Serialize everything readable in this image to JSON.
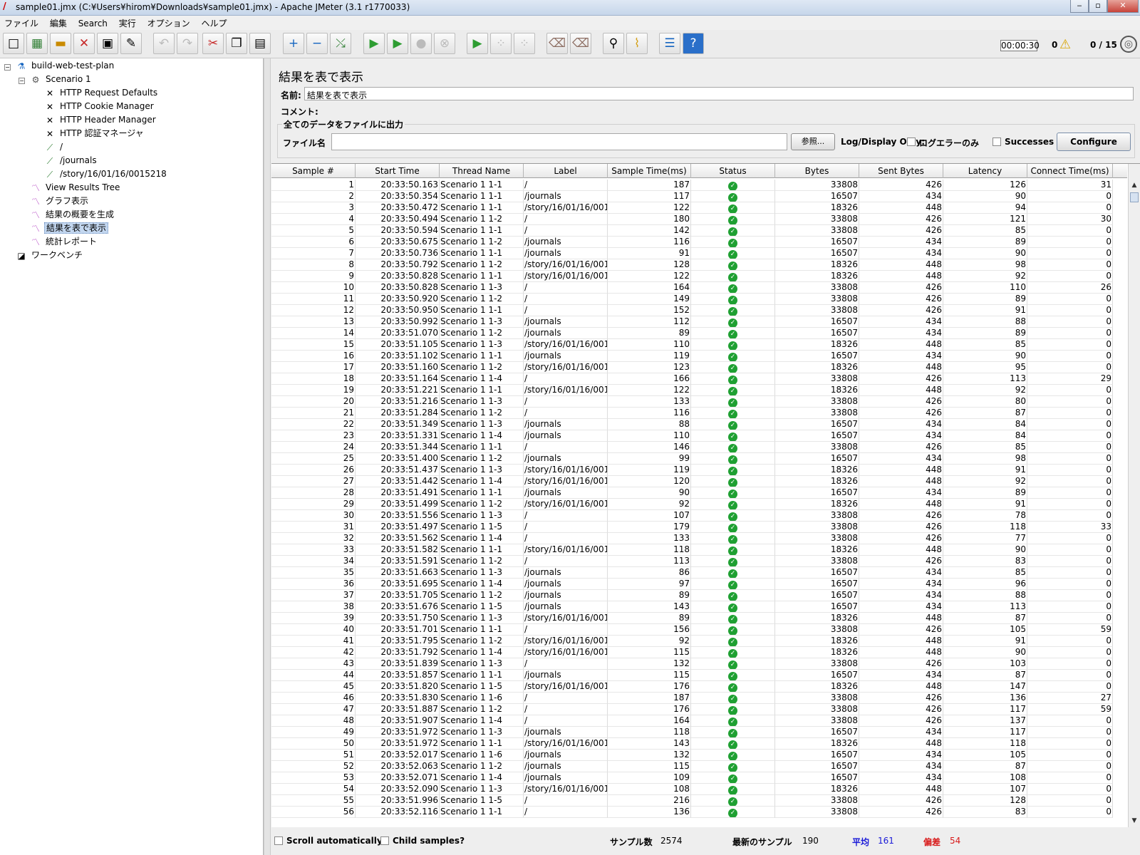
{
  "window": {
    "title": "sample01.jmx (C:¥Users¥hirom¥Downloads¥sample01.jmx) - Apache JMeter (3.1 r1770033)",
    "buttons": {
      "minimize": "‒",
      "maximize": "▫",
      "close": "✕"
    }
  },
  "menu": [
    "ファイル",
    "編集",
    "Search",
    "実行",
    "オプション",
    "ヘルプ"
  ],
  "toolbar": {
    "elapsed": "00:00:30",
    "warnings": "0",
    "threads": "0 / 15"
  },
  "tree": {
    "nodes": [
      {
        "label": "build-web-test-plan",
        "icon": "test-plan-icon"
      },
      {
        "label": "Scenario 1",
        "icon": "thread-group-icon"
      },
      {
        "label": "HTTP Request Defaults",
        "icon": "config-wrench-icon"
      },
      {
        "label": "HTTP Cookie Manager",
        "icon": "config-wrench-icon"
      },
      {
        "label": "HTTP Header Manager",
        "icon": "config-wrench-icon"
      },
      {
        "label": "HTTP 認証マネージャ",
        "icon": "config-wrench-icon"
      },
      {
        "label": "/",
        "icon": "sampler-pipette-icon"
      },
      {
        "label": "/journals",
        "icon": "sampler-pipette-icon"
      },
      {
        "label": "/story/16/01/16/0015218",
        "icon": "sampler-pipette-icon"
      },
      {
        "label": "View Results Tree",
        "icon": "listener-chart-icon"
      },
      {
        "label": "グラフ表示",
        "icon": "listener-chart-icon"
      },
      {
        "label": "結果の概要を生成",
        "icon": "listener-chart-icon"
      },
      {
        "label": "結果を表で表示",
        "icon": "listener-chart-icon"
      },
      {
        "label": "統計レポート",
        "icon": "listener-chart-icon"
      },
      {
        "label": "ワークベンチ",
        "icon": "workbench-icon"
      }
    ]
  },
  "panel": {
    "title": "結果を表で表示",
    "name_label": "名前:",
    "name_value": "結果を表で表示",
    "comment_label": "コメント:",
    "file_group_title": "全てのデータをファイルに出力",
    "file_label": "ファイル名",
    "browse_button": "参照...",
    "log_display_only": "Log/Display Only:",
    "errors_only": "ログエラーのみ",
    "successes": "Successes",
    "configure_button": "Configure"
  },
  "table": {
    "columns": [
      "Sample #",
      "Start Time",
      "Thread Name",
      "Label",
      "Sample Time(ms)",
      "Status",
      "Bytes",
      "Sent Bytes",
      "Latency",
      "Connect Time(ms)"
    ],
    "rows": [
      [
        1,
        "20:33:50.163",
        "Scenario 1 1-1",
        "/",
        187,
        "ok",
        33808,
        426,
        126,
        31
      ],
      [
        2,
        "20:33:50.354",
        "Scenario 1 1-1",
        "/journals",
        117,
        "ok",
        16507,
        434,
        90,
        0
      ],
      [
        3,
        "20:33:50.472",
        "Scenario 1 1-1",
        "/story/16/01/16/001...",
        122,
        "ok",
        18326,
        448,
        94,
        0
      ],
      [
        4,
        "20:33:50.494",
        "Scenario 1 1-2",
        "/",
        180,
        "ok",
        33808,
        426,
        121,
        30
      ],
      [
        5,
        "20:33:50.594",
        "Scenario 1 1-1",
        "/",
        142,
        "ok",
        33808,
        426,
        85,
        0
      ],
      [
        6,
        "20:33:50.675",
        "Scenario 1 1-2",
        "/journals",
        116,
        "ok",
        16507,
        434,
        89,
        0
      ],
      [
        7,
        "20:33:50.736",
        "Scenario 1 1-1",
        "/journals",
        91,
        "ok",
        16507,
        434,
        90,
        0
      ],
      [
        8,
        "20:33:50.792",
        "Scenario 1 1-2",
        "/story/16/01/16/001...",
        128,
        "ok",
        18326,
        448,
        98,
        0
      ],
      [
        9,
        "20:33:50.828",
        "Scenario 1 1-1",
        "/story/16/01/16/001...",
        122,
        "ok",
        18326,
        448,
        92,
        0
      ],
      [
        10,
        "20:33:50.828",
        "Scenario 1 1-3",
        "/",
        164,
        "ok",
        33808,
        426,
        110,
        26
      ],
      [
        11,
        "20:33:50.920",
        "Scenario 1 1-2",
        "/",
        149,
        "ok",
        33808,
        426,
        89,
        0
      ],
      [
        12,
        "20:33:50.950",
        "Scenario 1 1-1",
        "/",
        152,
        "ok",
        33808,
        426,
        91,
        0
      ],
      [
        13,
        "20:33:50.992",
        "Scenario 1 1-3",
        "/journals",
        112,
        "ok",
        16507,
        434,
        88,
        0
      ],
      [
        14,
        "20:33:51.070",
        "Scenario 1 1-2",
        "/journals",
        89,
        "ok",
        16507,
        434,
        89,
        0
      ],
      [
        15,
        "20:33:51.105",
        "Scenario 1 1-3",
        "/story/16/01/16/001...",
        110,
        "ok",
        18326,
        448,
        85,
        0
      ],
      [
        16,
        "20:33:51.102",
        "Scenario 1 1-1",
        "/journals",
        119,
        "ok",
        16507,
        434,
        90,
        0
      ],
      [
        17,
        "20:33:51.160",
        "Scenario 1 1-2",
        "/story/16/01/16/001...",
        123,
        "ok",
        18326,
        448,
        95,
        0
      ],
      [
        18,
        "20:33:51.164",
        "Scenario 1 1-4",
        "/",
        166,
        "ok",
        33808,
        426,
        113,
        29
      ],
      [
        19,
        "20:33:51.221",
        "Scenario 1 1-1",
        "/story/16/01/16/001...",
        122,
        "ok",
        18326,
        448,
        92,
        0
      ],
      [
        20,
        "20:33:51.216",
        "Scenario 1 1-3",
        "/",
        133,
        "ok",
        33808,
        426,
        80,
        0
      ],
      [
        21,
        "20:33:51.284",
        "Scenario 1 1-2",
        "/",
        116,
        "ok",
        33808,
        426,
        87,
        0
      ],
      [
        22,
        "20:33:51.349",
        "Scenario 1 1-3",
        "/journals",
        88,
        "ok",
        16507,
        434,
        84,
        0
      ],
      [
        23,
        "20:33:51.331",
        "Scenario 1 1-4",
        "/journals",
        110,
        "ok",
        16507,
        434,
        84,
        0
      ],
      [
        24,
        "20:33:51.344",
        "Scenario 1 1-1",
        "/",
        146,
        "ok",
        33808,
        426,
        85,
        0
      ],
      [
        25,
        "20:33:51.400",
        "Scenario 1 1-2",
        "/journals",
        99,
        "ok",
        16507,
        434,
        98,
        0
      ],
      [
        26,
        "20:33:51.437",
        "Scenario 1 1-3",
        "/story/16/01/16/001...",
        119,
        "ok",
        18326,
        448,
        91,
        0
      ],
      [
        27,
        "20:33:51.442",
        "Scenario 1 1-4",
        "/story/16/01/16/001...",
        120,
        "ok",
        18326,
        448,
        92,
        0
      ],
      [
        28,
        "20:33:51.491",
        "Scenario 1 1-1",
        "/journals",
        90,
        "ok",
        16507,
        434,
        89,
        0
      ],
      [
        29,
        "20:33:51.499",
        "Scenario 1 1-2",
        "/story/16/01/16/001...",
        92,
        "ok",
        18326,
        448,
        91,
        0
      ],
      [
        30,
        "20:33:51.556",
        "Scenario 1 1-3",
        "/",
        107,
        "ok",
        33808,
        426,
        78,
        0
      ],
      [
        31,
        "20:33:51.497",
        "Scenario 1 1-5",
        "/",
        179,
        "ok",
        33808,
        426,
        118,
        33
      ],
      [
        32,
        "20:33:51.562",
        "Scenario 1 1-4",
        "/",
        133,
        "ok",
        33808,
        426,
        77,
        0
      ],
      [
        33,
        "20:33:51.582",
        "Scenario 1 1-1",
        "/story/16/01/16/001...",
        118,
        "ok",
        18326,
        448,
        90,
        0
      ],
      [
        34,
        "20:33:51.591",
        "Scenario 1 1-2",
        "/",
        113,
        "ok",
        33808,
        426,
        83,
        0
      ],
      [
        35,
        "20:33:51.663",
        "Scenario 1 1-3",
        "/journals",
        86,
        "ok",
        16507,
        434,
        85,
        0
      ],
      [
        36,
        "20:33:51.695",
        "Scenario 1 1-4",
        "/journals",
        97,
        "ok",
        16507,
        434,
        96,
        0
      ],
      [
        37,
        "20:33:51.705",
        "Scenario 1 1-2",
        "/journals",
        89,
        "ok",
        16507,
        434,
        88,
        0
      ],
      [
        38,
        "20:33:51.676",
        "Scenario 1 1-5",
        "/journals",
        143,
        "ok",
        16507,
        434,
        113,
        0
      ],
      [
        39,
        "20:33:51.750",
        "Scenario 1 1-3",
        "/story/16/01/16/001...",
        89,
        "ok",
        18326,
        448,
        87,
        0
      ],
      [
        40,
        "20:33:51.701",
        "Scenario 1 1-1",
        "/",
        156,
        "ok",
        33808,
        426,
        105,
        59
      ],
      [
        41,
        "20:33:51.795",
        "Scenario 1 1-2",
        "/story/16/01/16/001...",
        92,
        "ok",
        18326,
        448,
        91,
        0
      ],
      [
        42,
        "20:33:51.792",
        "Scenario 1 1-4",
        "/story/16/01/16/001...",
        115,
        "ok",
        18326,
        448,
        90,
        0
      ],
      [
        43,
        "20:33:51.839",
        "Scenario 1 1-3",
        "/",
        132,
        "ok",
        33808,
        426,
        103,
        0
      ],
      [
        44,
        "20:33:51.857",
        "Scenario 1 1-1",
        "/journals",
        115,
        "ok",
        16507,
        434,
        87,
        0
      ],
      [
        45,
        "20:33:51.820",
        "Scenario 1 1-5",
        "/story/16/01/16/001...",
        176,
        "ok",
        18326,
        448,
        147,
        0
      ],
      [
        46,
        "20:33:51.830",
        "Scenario 1 1-6",
        "/",
        187,
        "ok",
        33808,
        426,
        136,
        27
      ],
      [
        47,
        "20:33:51.887",
        "Scenario 1 1-2",
        "/",
        176,
        "ok",
        33808,
        426,
        117,
        59
      ],
      [
        48,
        "20:33:51.907",
        "Scenario 1 1-4",
        "/",
        164,
        "ok",
        33808,
        426,
        137,
        0
      ],
      [
        49,
        "20:33:51.972",
        "Scenario 1 1-3",
        "/journals",
        118,
        "ok",
        16507,
        434,
        117,
        0
      ],
      [
        50,
        "20:33:51.972",
        "Scenario 1 1-1",
        "/story/16/01/16/001...",
        143,
        "ok",
        18326,
        448,
        118,
        0
      ],
      [
        51,
        "20:33:52.017",
        "Scenario 1 1-6",
        "/journals",
        132,
        "ok",
        16507,
        434,
        105,
        0
      ],
      [
        52,
        "20:33:52.063",
        "Scenario 1 1-2",
        "/journals",
        115,
        "ok",
        16507,
        434,
        87,
        0
      ],
      [
        53,
        "20:33:52.071",
        "Scenario 1 1-4",
        "/journals",
        109,
        "ok",
        16507,
        434,
        108,
        0
      ],
      [
        54,
        "20:33:52.090",
        "Scenario 1 1-3",
        "/story/16/01/16/001...",
        108,
        "ok",
        18326,
        448,
        107,
        0
      ],
      [
        55,
        "20:33:51.996",
        "Scenario 1 1-5",
        "/",
        216,
        "ok",
        33808,
        426,
        128,
        0
      ],
      [
        56,
        "20:33:52.116",
        "Scenario 1 1-1",
        "/",
        136,
        "ok",
        33808,
        426,
        83,
        0
      ]
    ]
  },
  "footer": {
    "scroll_auto": "Scroll automatically?",
    "child_samples": "Child samples?",
    "sample_count_label": "サンプル数",
    "sample_count": "2574",
    "latest_label": "最新のサンプル",
    "latest": "190",
    "average_label": "平均",
    "average": "161",
    "deviation_label": "偏差",
    "deviation": "54",
    "colors": {
      "average": "#1a1ad8",
      "deviation": "#d81a1a"
    }
  }
}
